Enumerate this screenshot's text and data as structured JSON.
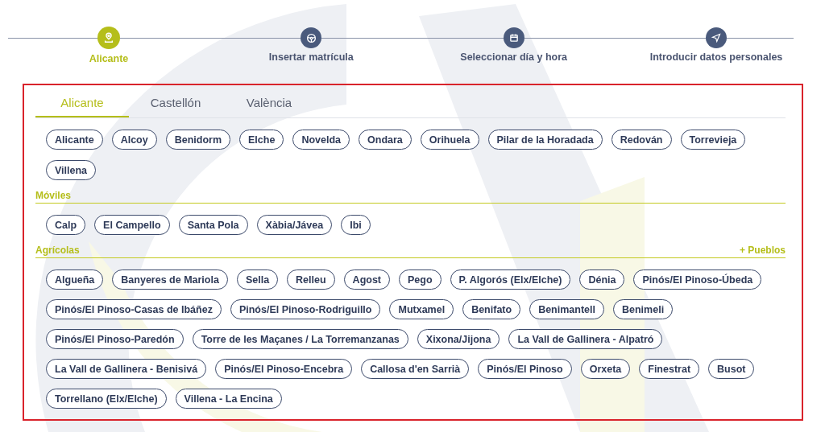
{
  "steps": [
    {
      "label": "Alicante",
      "kind": "pin",
      "selected": true
    },
    {
      "label": "Insertar matrícula",
      "kind": "wheel",
      "selected": false
    },
    {
      "label": "Seleccionar día y hora",
      "kind": "calendar",
      "selected": false
    },
    {
      "label": "Introducir datos personales",
      "kind": "send",
      "selected": false
    }
  ],
  "tabs": [
    {
      "label": "Alicante",
      "selected": true
    },
    {
      "label": "Castellón",
      "selected": false
    },
    {
      "label": "València",
      "selected": false
    }
  ],
  "groups": [
    {
      "chips": [
        "Alicante",
        "Alcoy",
        "Benidorm",
        "Elche",
        "Novelda",
        "Ondara",
        "Orihuela",
        "Pilar de la Horadada",
        "Redován",
        "Torrevieja",
        "Villena"
      ]
    },
    {
      "title": "Móviles",
      "chips": [
        "Calp",
        "El Campello",
        "Santa Pola",
        "Xàbia/Jávea",
        "Ibi"
      ]
    },
    {
      "title": "Agrícolas",
      "link": "+ Pueblos",
      "chips": [
        "Algueña",
        "Banyeres de Mariola",
        "Sella",
        "Relleu",
        "Agost",
        "Pego",
        "P. Algorós (Elx/Elche)",
        "Dénia",
        "Pinós/El Pinoso-Úbeda",
        "Pinós/El Pinoso-Casas de Ibáñez",
        "Pinós/El Pinoso-Rodriguillo",
        "Mutxamel",
        "Benifato",
        "Benimantell",
        "Benimeli",
        "Pinós/El Pinoso-Paredón",
        "Torre de les Maçanes / La Torremanzanas",
        "Xixona/Jijona",
        "La Vall de Gallinera - Alpatró",
        "La Vall de Gallinera - Benisivá",
        "Pinós/El Pinoso-Encebra",
        "Callosa d'en Sarrià",
        "Pinós/El Pinoso",
        "Orxeta",
        "Finestrat",
        "Busot",
        "Torrellano (Elx/Elche)",
        "Villena - La Encina"
      ]
    }
  ]
}
